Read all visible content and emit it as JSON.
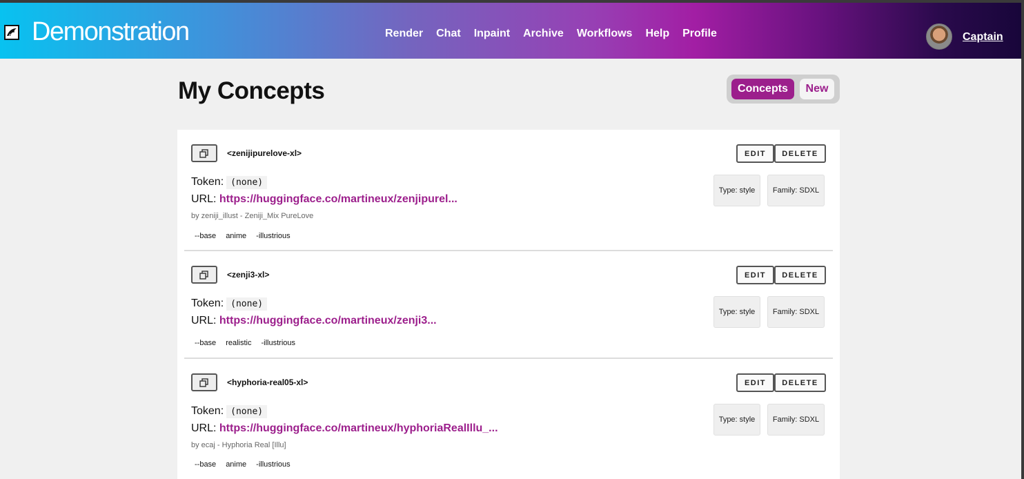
{
  "header": {
    "app_title": "Demonstration",
    "nav": [
      "Render",
      "Chat",
      "Inpaint",
      "Archive",
      "Workflows",
      "Help",
      "Profile"
    ],
    "user": "Captain"
  },
  "page": {
    "title": "My Concepts",
    "toggle": {
      "active": "Concepts",
      "inactive": "New"
    }
  },
  "labels": {
    "token": "Token:",
    "url": "URL:",
    "edit": "EDIT",
    "delete": "DELETE"
  },
  "concepts": [
    {
      "name": "<zenijipurelove-xl>",
      "token": "(none)",
      "url": "https://huggingface.co/martineux/zenjipurel...",
      "credit": "by zeniji_illust - Zeniji_Mix PureLove",
      "tags": [
        "--base",
        "anime",
        "-illustrious"
      ],
      "type": "Type: style",
      "family": "Family: SDXL"
    },
    {
      "name": "<zenji3-xl>",
      "token": "(none)",
      "url": "https://huggingface.co/martineux/zenji3...",
      "credit": "",
      "tags": [
        "--base",
        "realistic",
        "-illustrious"
      ],
      "type": "Type: style",
      "family": "Family: SDXL"
    },
    {
      "name": "<hyphoria-real05-xl>",
      "token": "(none)",
      "url": "https://huggingface.co/martineux/hyphoriaRealIllu_...",
      "credit": "by ecaj - Hyphoria Real [Illu]",
      "tags": [
        "--base",
        "anime",
        "-illustrious"
      ],
      "type": "Type: style",
      "family": "Family: SDXL"
    }
  ]
}
